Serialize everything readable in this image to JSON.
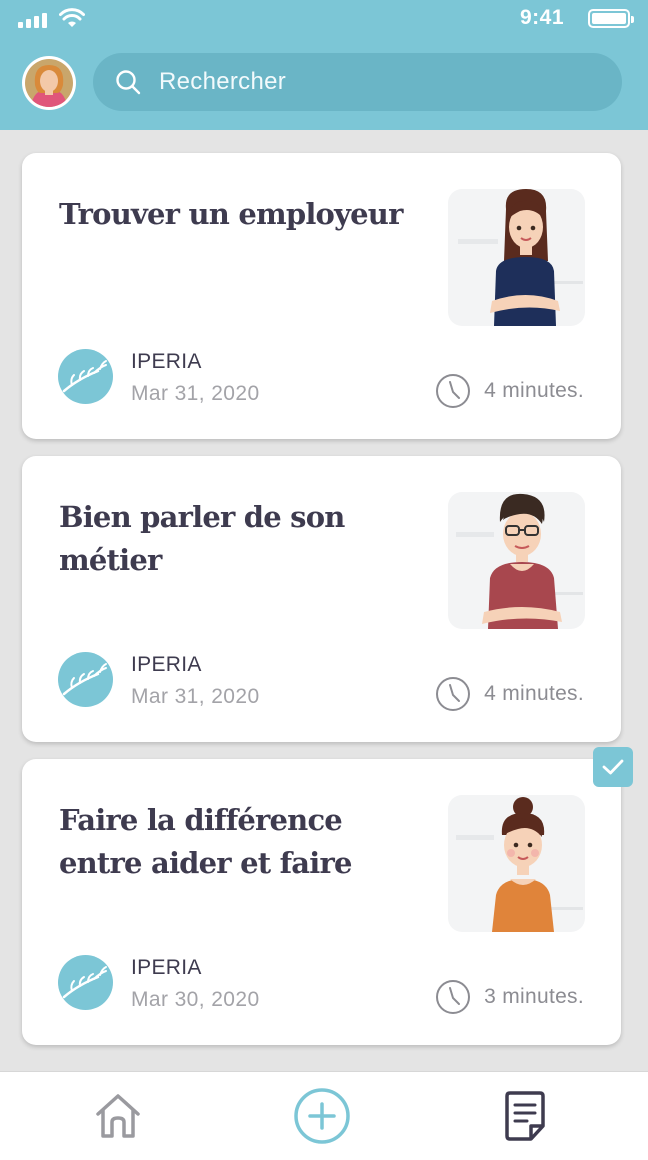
{
  "status_bar": {
    "time": "9:41",
    "icons": [
      "signal-icon",
      "wifi-icon",
      "battery-icon"
    ]
  },
  "header": {
    "avatar": "user-avatar",
    "search": {
      "placeholder": "Rechercher",
      "icon": "search-icon"
    }
  },
  "cards": [
    {
      "title": "Trouver un employeur",
      "source": "IPERIA",
      "date": "Mar 31, 2020",
      "duration": "4 minutes.",
      "completed": false,
      "illustration": "woman-brown-hair-navy-top"
    },
    {
      "title": "Bien parler de son métier",
      "source": "IPERIA",
      "date": "Mar 31, 2020",
      "duration": "4 minutes.",
      "completed": false,
      "illustration": "woman-short-hair-glasses-red-top"
    },
    {
      "title": "Faire la différence entre aider et faire",
      "source": "IPERIA",
      "date": "Mar 30, 2020",
      "duration": "3 minutes.",
      "completed": true,
      "illustration": "woman-bun-orange-top"
    }
  ],
  "bottom_nav": {
    "items": [
      "home-icon",
      "add-icon",
      "document-icon"
    ]
  },
  "colors": {
    "accent": "#7cc6d6",
    "title": "#3e3b4f",
    "muted": "#a3a3a8"
  }
}
